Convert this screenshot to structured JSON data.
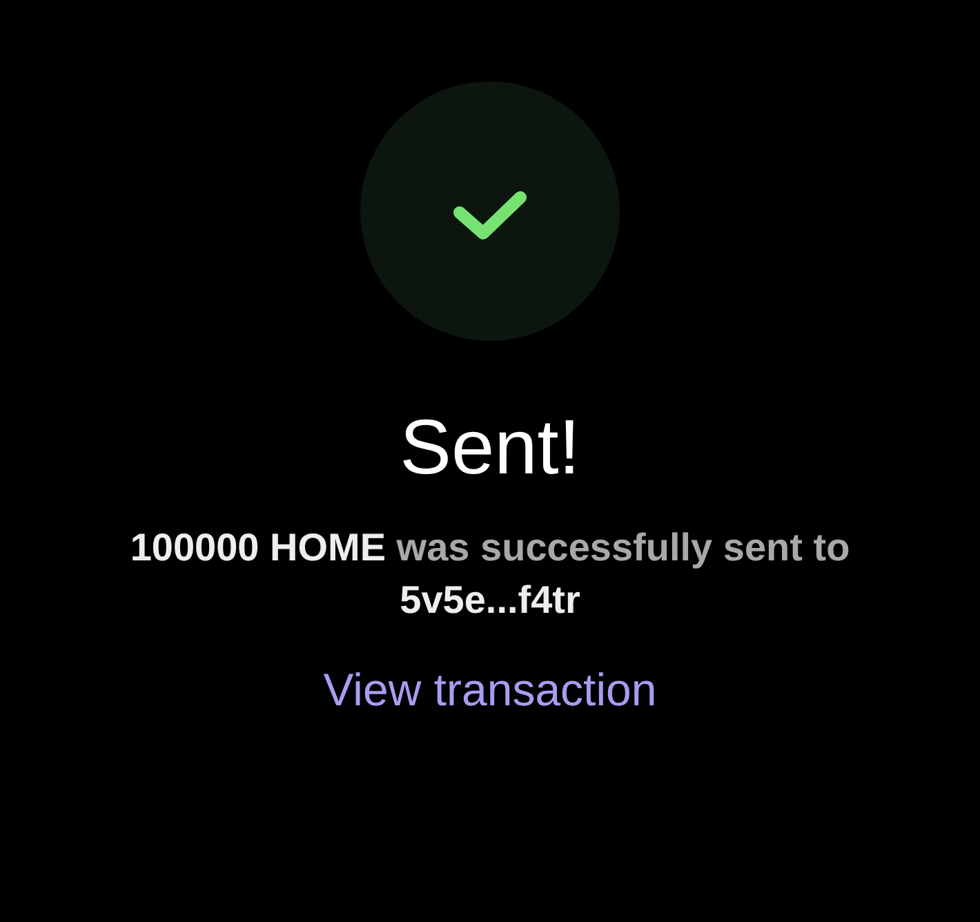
{
  "status_icon": {
    "kind": "success"
  },
  "title": "Sent!",
  "message": "**100000 HOME** was successfully sent to **5v5e...f4tr**",
  "link": {
    "label": "View transaction"
  }
}
